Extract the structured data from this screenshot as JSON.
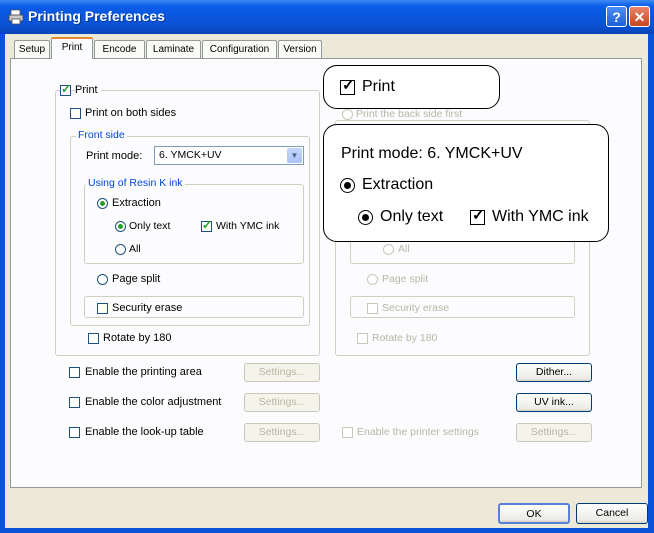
{
  "window": {
    "title": "Printing Preferences",
    "help_label": "?",
    "close_label": "✕"
  },
  "tabs": [
    {
      "label": "Setup"
    },
    {
      "label": "Print"
    },
    {
      "label": "Encode"
    },
    {
      "label": "Laminate"
    },
    {
      "label": "Configuration"
    },
    {
      "label": "Version"
    }
  ],
  "left": {
    "print_label": "Print",
    "both_sides_label": "Print on both sides",
    "front_side_title": "Front side",
    "print_mode_label": "Print mode:",
    "print_mode_value": "6. YMCK+UV",
    "resin_title": "Using of Resin K ink",
    "extraction_label": "Extraction",
    "only_text_label": "Only text",
    "with_ymc_label": "With YMC ink",
    "all_label": "All",
    "page_split_label": "Page split",
    "security_erase_label": "Security erase",
    "rotate_label": "Rotate by 180"
  },
  "right": {
    "back_first_label": "Print the back side first",
    "all_label": "All",
    "page_split_label": "Page split",
    "security_erase_label": "Security erase",
    "rotate_label": "Rotate by 180"
  },
  "options": {
    "printing_area_label": "Enable the printing area",
    "color_adjust_label": "Enable the color adjustment",
    "lookup_label": "Enable the look-up table",
    "printer_settings_label": "Enable the printer settings",
    "settings_label": "Settings...",
    "dither_label": "Dither...",
    "uv_ink_label": "UV ink..."
  },
  "footer": {
    "ok_label": "OK",
    "cancel_label": "Cancel"
  },
  "callouts": {
    "print_label": "Print",
    "print_mode_text": "Print mode:  6. YMCK+UV",
    "extraction_label": "Extraction",
    "only_text_label": "Only text",
    "with_ymc_label": "With YMC ink"
  },
  "colors": {
    "titlebar": "#0a53d9",
    "dialog_bg": "#ece9d8",
    "group_title": "#0046d5",
    "check_mark": "#21a121",
    "disabled_text": "#b9b6a5",
    "active_tab_accent": "#e68b2c"
  }
}
